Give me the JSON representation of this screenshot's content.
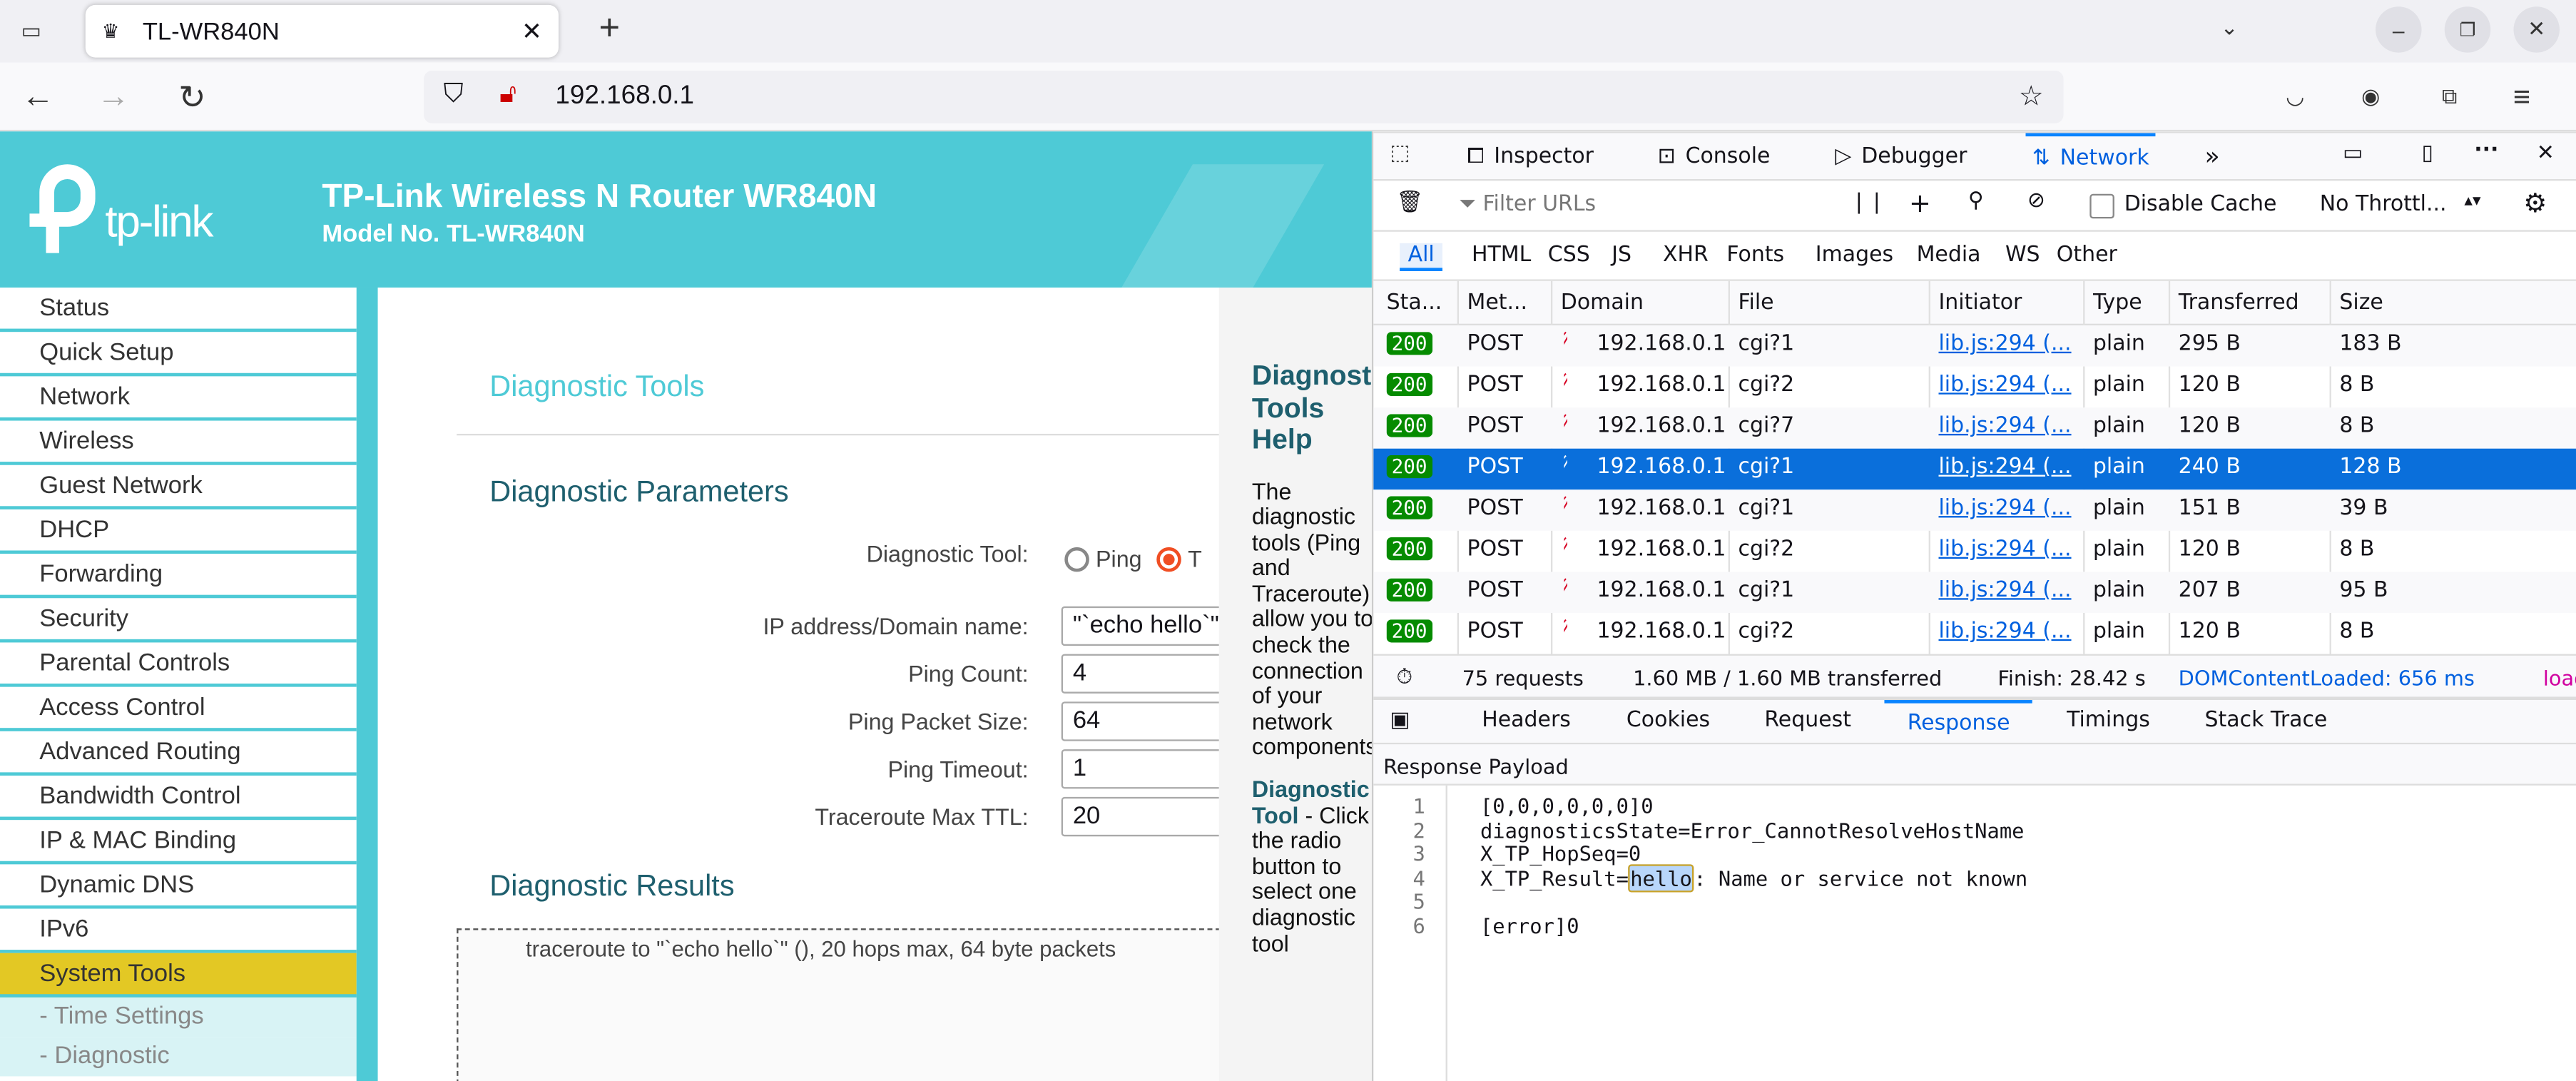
{
  "browser": {
    "tab_title": "TL-WR840N",
    "url": "192.168.0.1"
  },
  "router": {
    "title": "TP-Link Wireless N Router WR840N",
    "model": "Model No. TL-WR840N",
    "logo_text": "tp-link",
    "sidebar": [
      "Status",
      "Quick Setup",
      "Network",
      "Wireless",
      "Guest Network",
      "DHCP",
      "Forwarding",
      "Security",
      "Parental Controls",
      "Access Control",
      "Advanced Routing",
      "Bandwidth Control",
      "IP & MAC Binding",
      "Dynamic DNS",
      "IPv6",
      "System Tools"
    ],
    "subitems": [
      "- Time Settings",
      "- Diagnostic"
    ],
    "page_title": "Diagnostic Tools",
    "params_title": "Diagnostic Parameters",
    "tool_label": "Diagnostic Tool:",
    "ping_label": "Ping",
    "trace_label": "T",
    "fields": [
      {
        "label": "IP address/Domain name:",
        "value": "\"`echo hello`\""
      },
      {
        "label": "Ping Count:",
        "value": "4"
      },
      {
        "label": "Ping Packet Size:",
        "value": "64"
      },
      {
        "label": "Ping Timeout:",
        "value": "1"
      },
      {
        "label": "Traceroute Max TTL:",
        "value": "20"
      }
    ],
    "results_title": "Diagnostic Results",
    "results_text": "traceroute to \"`echo hello`\" (), 20 hops max, 64 byte packets",
    "help_title": "Diagnostic Tools Help",
    "help_p1": "The diagnostic tools (Ping and Traceroute) allow you to check the connection of your network components",
    "help_term": "Diagnostic Tool",
    "help_p2": " - Click the radio button to select one diagnostic tool"
  },
  "devtools": {
    "tabs": [
      "Inspector",
      "Console",
      "Debugger",
      "Network"
    ],
    "filter_placeholder": "Filter URLs",
    "disable_cache": "Disable Cache",
    "throttle": "No Throttl...",
    "type_filters": [
      "All",
      "HTML",
      "CSS",
      "JS",
      "XHR",
      "Fonts",
      "Images",
      "Media",
      "WS",
      "Other"
    ],
    "columns": [
      "Sta...",
      "Met...",
      "Domain",
      "File",
      "Initiator",
      "Type",
      "Transferred",
      "Size"
    ],
    "rows": [
      [
        "200",
        "POST",
        "192.168.0.1",
        "cgi?1",
        "lib.js:294 (...",
        "plain",
        "295 B",
        "183 B"
      ],
      [
        "200",
        "POST",
        "192.168.0.1",
        "cgi?2",
        "lib.js:294 (...",
        "plain",
        "120 B",
        "8 B"
      ],
      [
        "200",
        "POST",
        "192.168.0.1",
        "cgi?7",
        "lib.js:294 (...",
        "plain",
        "120 B",
        "8 B"
      ],
      [
        "200",
        "POST",
        "192.168.0.1",
        "cgi?1",
        "lib.js:294 (...",
        "plain",
        "240 B",
        "128 B"
      ],
      [
        "200",
        "POST",
        "192.168.0.1",
        "cgi?1",
        "lib.js:294 (...",
        "plain",
        "151 B",
        "39 B"
      ],
      [
        "200",
        "POST",
        "192.168.0.1",
        "cgi?2",
        "lib.js:294 (...",
        "plain",
        "120 B",
        "8 B"
      ],
      [
        "200",
        "POST",
        "192.168.0.1",
        "cgi?1",
        "lib.js:294 (...",
        "plain",
        "207 B",
        "95 B"
      ],
      [
        "200",
        "POST",
        "192.168.0.1",
        "cgi?2",
        "lib.js:294 (...",
        "plain",
        "120 B",
        "8 B"
      ]
    ],
    "selected_row": 3,
    "summary": {
      "requests": "75 requests",
      "transferred": "1.60 MB / 1.60 MB transferred",
      "finish": "Finish: 28.42 s",
      "dcl": "DOMContentLoaded: 656 ms",
      "load": "load"
    },
    "detail_tabs": [
      "Headers",
      "Cookies",
      "Request",
      "Response",
      "Timings",
      "Stack Trace"
    ],
    "payload_title": "Response Payload",
    "lines": [
      {
        "n": "1",
        "pre": "[0,0,0,0,0,0]0"
      },
      {
        "n": "2",
        "pre": "diagnosticsState=Error_CannotResolveHostName"
      },
      {
        "n": "3",
        "pre": "X_TP_HopSeq=0"
      },
      {
        "n": "4",
        "pre": "X_TP_Result=",
        "hl": "hello",
        "post": ": Name or service not known"
      },
      {
        "n": "5",
        "pre": ""
      },
      {
        "n": "6",
        "pre": "[error]0"
      }
    ]
  }
}
